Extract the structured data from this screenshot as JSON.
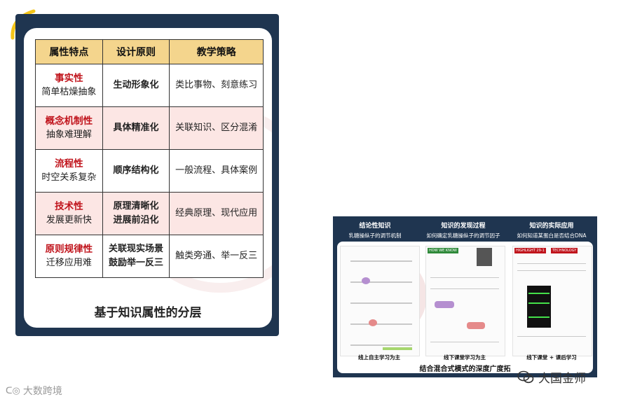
{
  "left_card": {
    "headers": [
      "属性特点",
      "设计原则",
      "教学策略"
    ],
    "rows": [
      {
        "name": "事实性",
        "desc": "简单枯燥抽象",
        "principle": [
          "生动形象化"
        ],
        "strategy": "类比事物、刻意练习"
      },
      {
        "name": "概念机制性",
        "desc": "抽象难理解",
        "principle": [
          "具体精准化"
        ],
        "strategy": "关联知识、区分混淆"
      },
      {
        "name": "流程性",
        "desc": "时空关系复杂",
        "principle": [
          "顺序结构化"
        ],
        "strategy": "一般流程、具体案例"
      },
      {
        "name": "技术性",
        "desc": "发展更新快",
        "principle": [
          "原理清晰化",
          "进展前沿化"
        ],
        "strategy": "经典原理、现代应用"
      },
      {
        "name": "原则规律性",
        "desc": "迁移应用难",
        "principle": [
          "关联现实场景",
          "鼓励举一反三"
        ],
        "strategy": "触类旁通、举一反三"
      }
    ],
    "caption": "基于知识属性的分层"
  },
  "right_panel": {
    "columns": [
      {
        "title": "结论性知识",
        "subtitle": "乳糖操纵子的调节机制",
        "footer": "线上自主学习为主"
      },
      {
        "title": "知识的发现过程",
        "subtitle": "如何确定乳糖操纵子的调节因子",
        "footer": "线下课堂学习为主",
        "tag": "HOW WE KNOW"
      },
      {
        "title": "知识的实际应用",
        "subtitle": "如何知道某蛋白是否结合DNA",
        "footer": "线下课堂 + 课后学习",
        "tag": "HIGHLIGHT 29-1",
        "tag2": "TECHNOLOGY"
      }
    ],
    "caption": "结合混合式模式的深度广度拓"
  },
  "logos": {
    "left": "大数跨境",
    "right": "大国金师"
  },
  "colors": {
    "navy": "#1f3550",
    "header": "#f4d58d",
    "pink_row": "#fce6e4",
    "red_text": "#c0141c",
    "yellow_accent": "#f5c518"
  }
}
